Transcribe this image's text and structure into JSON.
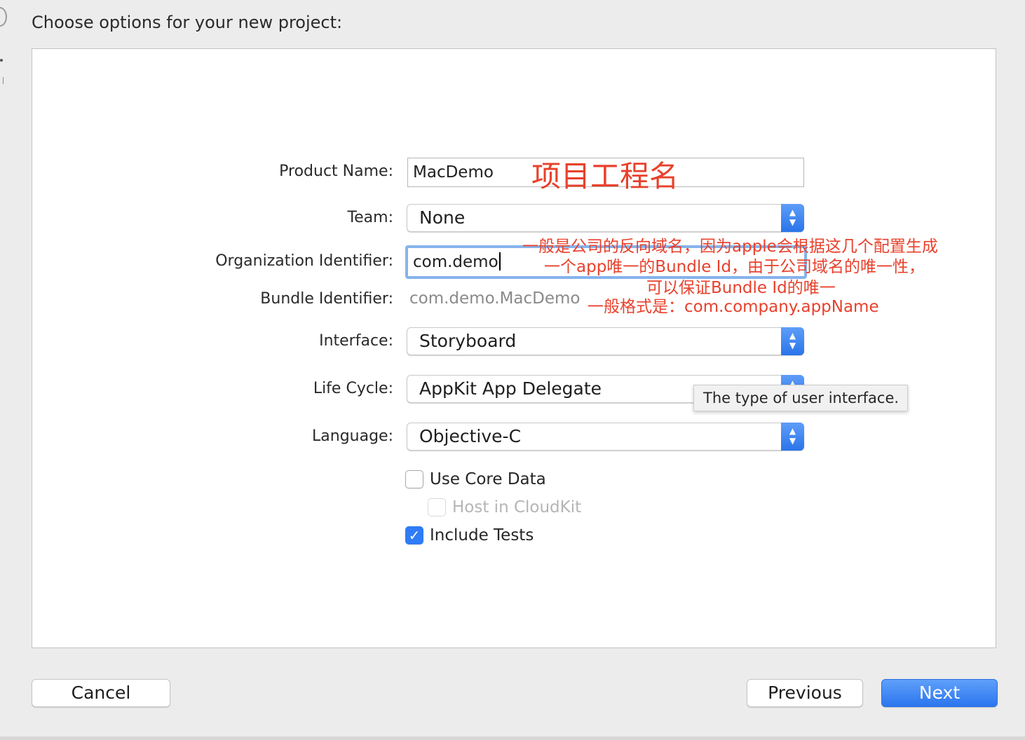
{
  "window": {
    "title": "Choose options for your new project:"
  },
  "form": {
    "product_name": {
      "label": "Product Name:",
      "value": "MacDemo"
    },
    "team": {
      "label": "Team:",
      "value": "None"
    },
    "organization_identifier": {
      "label": "Organization Identifier:",
      "value": "com.demo"
    },
    "bundle_identifier": {
      "label": "Bundle Identifier:",
      "value": "com.demo.MacDemo"
    },
    "interface": {
      "label": "Interface:",
      "value": "Storyboard"
    },
    "life_cycle": {
      "label": "Life Cycle:",
      "value": "AppKit App Delegate"
    },
    "language": {
      "label": "Language:",
      "value": "Objective-C"
    },
    "use_core_data": {
      "label": "Use Core Data",
      "checked": false
    },
    "host_in_cloudkit": {
      "label": "Host in CloudKit",
      "checked": false,
      "disabled": true
    },
    "include_tests": {
      "label": "Include Tests",
      "checked": true
    }
  },
  "tooltip": {
    "text": "The type of user interface."
  },
  "annotations": {
    "product_name_note": "项目工程名",
    "org_note_line1": "一般是公司的反向域名，因为apple会根据这几个配置生成",
    "org_note_line2": "一个app唯一的Bundle Id，由于公司域名的唯一性，",
    "org_note_line3": "可以保证Bundle Id的唯一",
    "format_note": "一般格式是：com.company.appName"
  },
  "buttons": {
    "cancel": "Cancel",
    "previous": "Previous",
    "next": "Next"
  },
  "icons": {
    "checkmark": "✓",
    "stepper_up": "▲",
    "stepper_down": "▼"
  },
  "colors": {
    "accent": "#2f7cf6",
    "annotation": "#e8412c",
    "focus_ring": "#86b3ec"
  }
}
